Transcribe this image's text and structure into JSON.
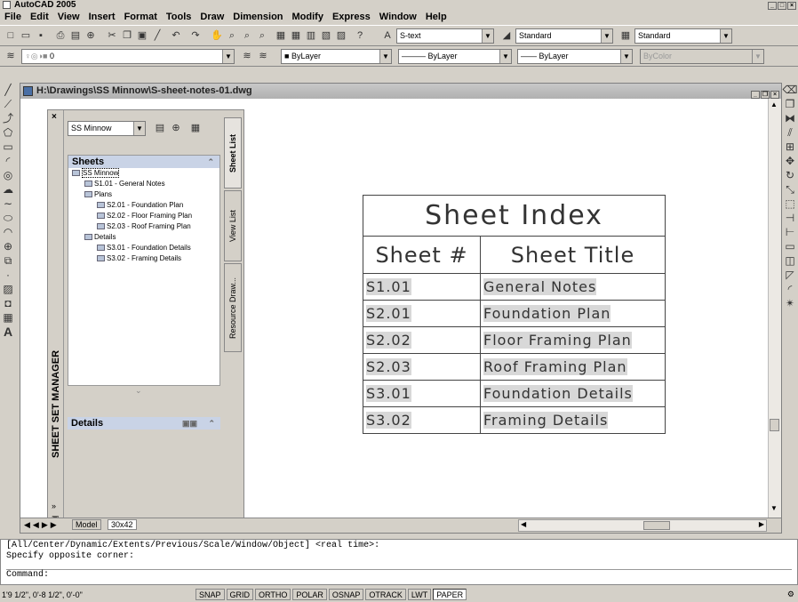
{
  "app": {
    "title": "AutoCAD 2005"
  },
  "menu": [
    "File",
    "Edit",
    "View",
    "Insert",
    "Format",
    "Tools",
    "Draw",
    "Dimension",
    "Modify",
    "Express",
    "Window",
    "Help"
  ],
  "toolbar": {
    "text_style": "S-text",
    "dim_style": "Standard",
    "table_style": "Standard",
    "layer": "0",
    "color": "ByLayer",
    "linetype": "ByLayer",
    "lineweight": "ByLayer",
    "plotstyle": "ByColor"
  },
  "drawing": {
    "title": "H:\\Drawings\\SS Minnow\\S-sheet-notes-01.dwg"
  },
  "ssm": {
    "vertical_label": "SHEET SET MANAGER",
    "set_selector": "SS Minnow",
    "tabs": [
      "Sheet List",
      "View List",
      "Resource Draw..."
    ],
    "sheets_header": "Sheets",
    "details_header": "Details",
    "tree": [
      {
        "label": "SS Minnow",
        "level": 0
      },
      {
        "label": "S1.01 - General Notes",
        "level": 1
      },
      {
        "label": "Plans",
        "level": 1
      },
      {
        "label": "S2.01 - Foundation Plan",
        "level": 2
      },
      {
        "label": "S2.02 - Floor Framing Plan",
        "level": 2
      },
      {
        "label": "S2.03 - Roof Framing Plan",
        "level": 2
      },
      {
        "label": "Details",
        "level": 1
      },
      {
        "label": "S3.01 - Foundation Details",
        "level": 2
      },
      {
        "label": "S3.02 - Framing Details",
        "level": 2
      }
    ]
  },
  "sheet_index": {
    "title": "Sheet Index",
    "col1": "Sheet #",
    "col2": "Sheet Title",
    "rows": [
      {
        "num": "S1.01",
        "title": "General Notes"
      },
      {
        "num": "S2.01",
        "title": "Foundation Plan"
      },
      {
        "num": "S2.02",
        "title": "Floor Framing Plan"
      },
      {
        "num": "S2.03",
        "title": "Roof Framing Plan"
      },
      {
        "num": "S3.01",
        "title": "Foundation Details"
      },
      {
        "num": "S3.02",
        "title": "Framing Details"
      }
    ]
  },
  "layout_tabs": [
    "Model",
    "30x42"
  ],
  "command": {
    "line1": "[All/Center/Dynamic/Extents/Previous/Scale/Window/Object] <real time>:",
    "line2": "Specify opposite corner:",
    "prompt": "Command:"
  },
  "status": {
    "coords": "1'9 1/2\", 0'-8 1/2\", 0'-0\"",
    "buttons": [
      "SNAP",
      "GRID",
      "ORTHO",
      "POLAR",
      "OSNAP",
      "OTRACK",
      "LWT",
      "PAPER"
    ],
    "active": "PAPER"
  }
}
